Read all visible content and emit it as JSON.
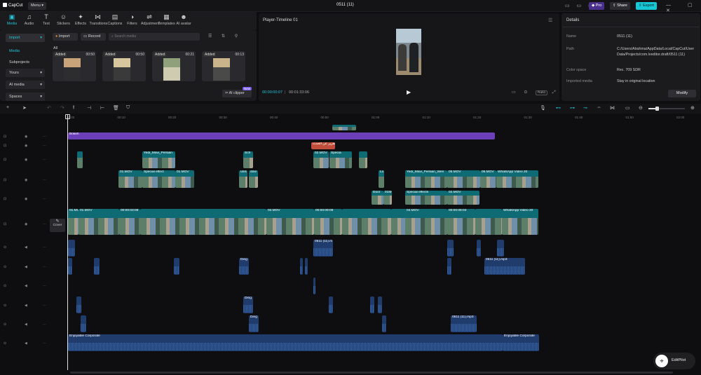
{
  "app": {
    "logo": "CapCut",
    "menu": "Menu",
    "title": "0511 (11)",
    "pro": "Pro",
    "share": "Share",
    "export": "Export"
  },
  "toolbar": [
    {
      "label": "Media",
      "icon": "media-icon",
      "active": true
    },
    {
      "label": "Audio",
      "icon": "audio-icon"
    },
    {
      "label": "Text",
      "icon": "text-icon"
    },
    {
      "label": "Stickers",
      "icon": "stickers-icon"
    },
    {
      "label": "Effects",
      "icon": "effects-icon"
    },
    {
      "label": "Transitions",
      "icon": "transitions-icon"
    },
    {
      "label": "Captions",
      "icon": "captions-icon"
    },
    {
      "label": "Filters",
      "icon": "filters-icon"
    },
    {
      "label": "Adjustment",
      "icon": "adjustment-icon"
    },
    {
      "label": "Templates",
      "icon": "templates-icon"
    },
    {
      "label": "AI avatar",
      "icon": "ai-avatar-icon"
    }
  ],
  "media": {
    "sidebar": [
      "Import",
      "Media",
      "Subprojects",
      "Yours",
      "AI media",
      "Spaces"
    ],
    "import_btn": "Import",
    "record_btn": "Record",
    "search_placeholder": "Search media",
    "section": "All",
    "thumbs": [
      {
        "badge": "Added",
        "duration": "00:50"
      },
      {
        "badge": "Added",
        "duration": "00:50"
      },
      {
        "badge": "Added",
        "duration": "00:21"
      },
      {
        "badge": "Added",
        "duration": "00:13"
      }
    ],
    "ai_clipper": "AI clipper",
    "new_badge": "New"
  },
  "player": {
    "title": "Player-Timeline 01",
    "current": "00:00:00:07",
    "total": "00:01:33:06",
    "ratio": "Ratio"
  },
  "details": {
    "title": "Details",
    "fields": [
      {
        "k": "Name",
        "v": "0511 (11)"
      },
      {
        "k": "Path",
        "v": "C:/Users/Alrahma/AppData/Local/CapCut/User Data/Projects/com.lveditor.draft/0511 (11)"
      },
      {
        "k": "Color space",
        "v": "Rec. 709 SDR"
      },
      {
        "k": "Imported media",
        "v": "Stay in original location"
      }
    ],
    "modify": "Modify"
  },
  "ruler": [
    "00:00",
    "00:10",
    "00:20",
    "00:30",
    "00:40",
    "00:50",
    "01:00",
    "01:10",
    "01:20",
    "01:30",
    "01:40",
    "01:50",
    "02:00"
  ],
  "timeline": {
    "cover": "Cover",
    "top_bar": "Bokeh",
    "red_text": "تقرير عن الحدث",
    "main_labels": [
      "01.MOV",
      "01.MOV",
      "00:00:03:08",
      "02.MOV",
      "00:00:09:08",
      "04.MOV",
      "00:00:08:03",
      "WhatsApp Video 20"
    ],
    "upper_labels": [
      "Yedi_Mavi_Persian",
      "Sch",
      "02.MOV",
      "Specia",
      "01.MOV",
      "Special effect",
      "01.MOV",
      "unis",
      "dow",
      "Lo",
      "Yedi_Mavi_Persian_Wen",
      "05.MOV",
      "06.MOV",
      "WhatsApp Video 20"
    ],
    "lower_labels": [
      "Door",
      "01MOV",
      "Special effects",
      "02.MOV"
    ],
    "audio_labels": [
      "Ding",
      "Ding",
      "Ding",
      "0511 (11).m",
      "0511 (11).mp3",
      "0511 (11).mp3"
    ],
    "music": "Enjoyable Corporate"
  },
  "editpilot": "EditPilot"
}
